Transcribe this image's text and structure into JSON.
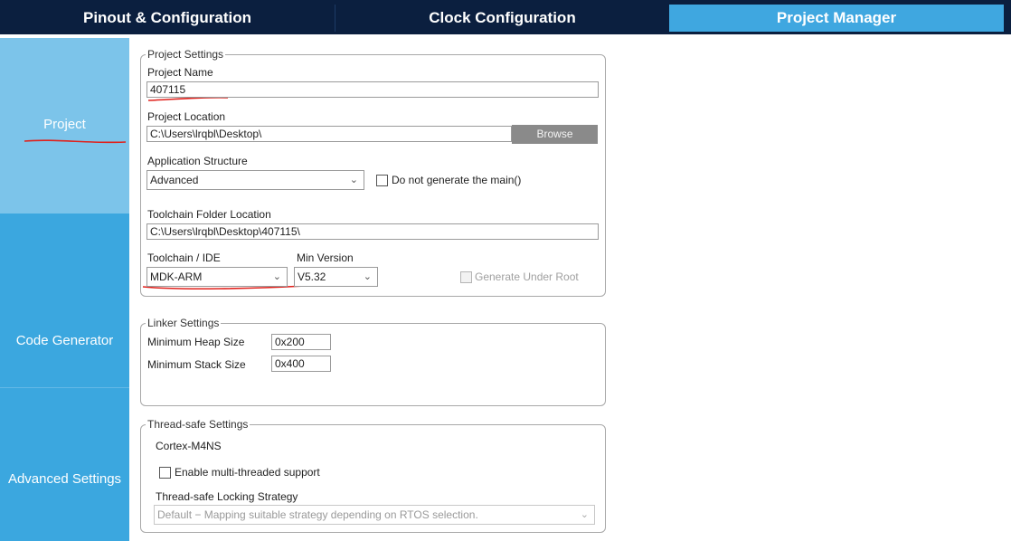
{
  "tabs": [
    {
      "label": "Pinout & Configuration",
      "active": false
    },
    {
      "label": "Clock Configuration",
      "active": false
    },
    {
      "label": "Project Manager",
      "active": true
    }
  ],
  "sidebar": {
    "items": [
      {
        "label": "Project",
        "selected": true
      },
      {
        "label": "Code Generator",
        "selected": false
      },
      {
        "label": "Advanced Settings",
        "selected": false
      }
    ]
  },
  "project_settings": {
    "title": "Project Settings",
    "project_name_label": "Project Name",
    "project_name_value": "407115",
    "project_location_label": "Project Location",
    "project_location_value": "C:\\Users\\lrqbl\\Desktop\\",
    "browse_label": "Browse",
    "app_structure_label": "Application Structure",
    "app_structure_value": "Advanced",
    "do_not_generate_main_label": "Do not generate the main()",
    "do_not_generate_main_checked": false,
    "toolchain_folder_label": "Toolchain Folder Location",
    "toolchain_folder_value": "C:\\Users\\lrqbl\\Desktop\\407115\\",
    "toolchain_ide_label": "Toolchain / IDE",
    "toolchain_ide_value": "MDK-ARM",
    "min_version_label": "Min Version",
    "min_version_value": "V5.32",
    "generate_under_root_label": "Generate Under Root",
    "generate_under_root_checked": false
  },
  "linker_settings": {
    "title": "Linker Settings",
    "heap_label": "Minimum Heap Size",
    "heap_value": "0x200",
    "stack_label": "Minimum Stack Size",
    "stack_value": "0x400"
  },
  "thread_safe_settings": {
    "title": "Thread-safe Settings",
    "core_label": "Cortex-M4NS",
    "enable_multithread_label": "Enable multi-threaded support",
    "enable_multithread_checked": false,
    "locking_strategy_label": "Thread-safe Locking Strategy",
    "locking_strategy_value": "Default  −  Mapping suitable strategy depending on RTOS selection."
  },
  "colors": {
    "tabbar_bg": "#0b1f3f",
    "active_tab_bg": "#3fa7e0",
    "sidebar_selected_bg": "#7cc4ea",
    "sidebar_bg": "#3ba7df",
    "annotation_red": "#e0201b"
  },
  "icons": {
    "dropdown": "chevron-down-icon",
    "checkbox": "checkbox-icon"
  }
}
